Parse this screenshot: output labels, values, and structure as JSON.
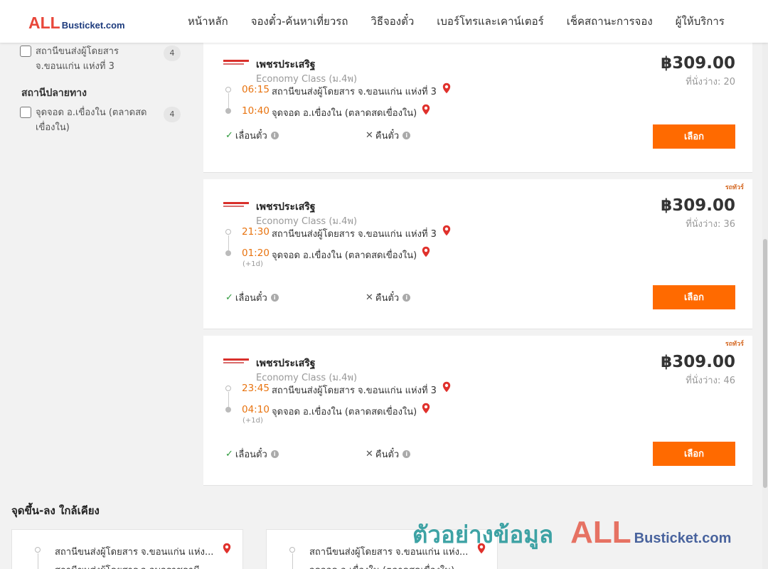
{
  "header": {
    "logo_big": "ALL",
    "logo_small": "Busticket.com",
    "nav": [
      "หน้าหลัก",
      "จองตั๋ว-ค้นหาเที่ยวรถ",
      "วิธีจองตั๋ว",
      "เบอร์โทรและเคาน์เตอร์",
      "เช็คสถานะการจอง",
      "ผู้ให้บริการ"
    ]
  },
  "filters": {
    "origin_item": {
      "label": "สถานีขนส่งผู้โดยสาร จ.ขอนแก่น แห่งที่ 3",
      "count": "4"
    },
    "destination_title": "สถานีปลายทาง",
    "destination_item": {
      "label": "จุดจอด อ.เขื่องใน (ตลาดสดเขื่องใน)",
      "count": "4"
    }
  },
  "trips": [
    {
      "operator": "เพชรประเสริฐ",
      "class": "Economy Class (ม.4พ)",
      "price": "฿309.00",
      "seats": "ที่นั่งว่าง: 20",
      "vip_tag": "",
      "depart_time": "06:15",
      "depart_place": "สถานีขนส่งผู้โดยสาร จ.ขอนแก่น แห่งที่ 3",
      "arrive_time": "10:40",
      "arrive_place": "จุดจอด อ.เขื่องใน (ตลาดสดเขื่องใน)",
      "next_day": "",
      "policy_change": "เลื่อนตั๋ว",
      "policy_refund": "คืนตั๋ว",
      "select_label": "เลือก"
    },
    {
      "operator": "เพชรประเสริฐ",
      "class": "Economy Class (ม.4พ)",
      "price": "฿309.00",
      "seats": "ที่นั่งว่าง: 36",
      "vip_tag": "รถทัวร์",
      "depart_time": "21:30",
      "depart_place": "สถานีขนส่งผู้โดยสาร จ.ขอนแก่น แห่งที่ 3",
      "arrive_time": "01:20",
      "arrive_place": "จุดจอด อ.เขื่องใน (ตลาดสดเขื่องใน)",
      "next_day": "(+1d)",
      "policy_change": "เลื่อนตั๋ว",
      "policy_refund": "คืนตั๋ว",
      "select_label": "เลือก"
    },
    {
      "operator": "เพชรประเสริฐ",
      "class": "Economy Class (ม.4พ)",
      "price": "฿309.00",
      "seats": "ที่นั่งว่าง: 46",
      "vip_tag": "รถทัวร์",
      "depart_time": "23:45",
      "depart_place": "สถานีขนส่งผู้โดยสาร จ.ขอนแก่น แห่งที่ 3",
      "arrive_time": "04:10",
      "arrive_place": "จุดจอด อ.เขื่องใน (ตลาดสดเขื่องใน)",
      "next_day": "(+1d)",
      "policy_change": "เลื่อนตั๋ว",
      "policy_refund": "คืนตั๋ว",
      "select_label": "เลือก"
    }
  ],
  "nearby": {
    "title": "จุดขึ้น-ลง ใกล้เคียง",
    "cards": [
      {
        "from": "สถานีขนส่งผู้โดยสาร จ.ขอนแก่น แห่ง...",
        "to": "สถานีขนส่งผู้โดยสาร จ.อุบลราชธานี"
      },
      {
        "from": "สถานีขนส่งผู้โดยสาร จ.ขอนแก่น แห่ง...",
        "to": "จุดจอด อ.เขื่องใน (ตลาดสดเขื่องใน)"
      }
    ]
  },
  "watermark": {
    "thai": "ตัวอย่างข้อมูล",
    "big": "ALL",
    "small": "Busticket.com"
  },
  "icons": {
    "pin": "map-pin-icon",
    "check": "check-icon",
    "cross": "cross-icon",
    "info": "info-icon"
  },
  "colors": {
    "accent": "#ff6a00",
    "time": "#e8730f",
    "pin": "#e0312c",
    "brand_red": "#e8473a",
    "brand_blue": "#1d3b7d"
  }
}
